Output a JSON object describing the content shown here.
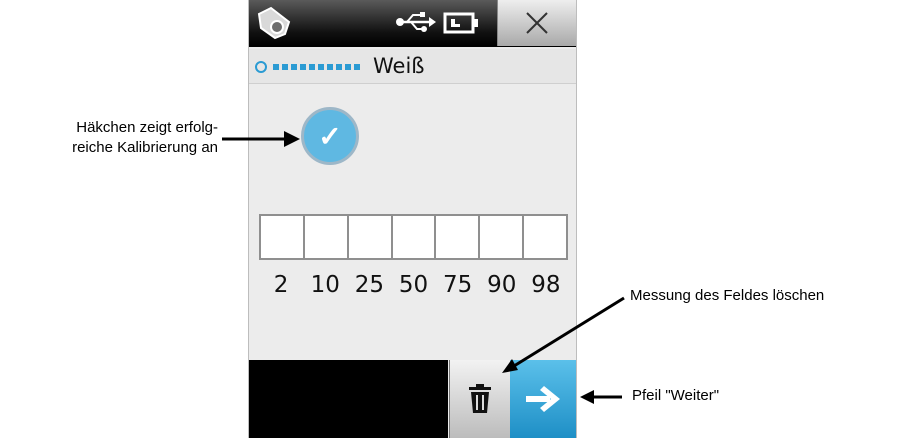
{
  "header": {
    "title": "Weiß",
    "icons": [
      "instrument-icon",
      "usb-icon",
      "battery-icon",
      "close-icon"
    ],
    "progress": {
      "current": 1,
      "total": 8
    }
  },
  "status": {
    "icon": "check-icon",
    "check_glyph": "✓"
  },
  "patch_fields": {
    "labels": [
      "2",
      "10",
      "25",
      "50",
      "75",
      "90",
      "98"
    ]
  },
  "actions": {
    "icons": [
      "trash-icon",
      "right-arrow-icon"
    ]
  },
  "annotations": {
    "calibration_line1": "Häkchen zeigt erfolg-",
    "calibration_line2": "reiche Kalibrierung an",
    "delete": "Messung des Feldes löschen",
    "next": "Pfeil \"Weiter\""
  },
  "colors": {
    "accent": "#2b9bd3",
    "check": "#5fb8e2",
    "next_button": "#1e8fc6"
  }
}
